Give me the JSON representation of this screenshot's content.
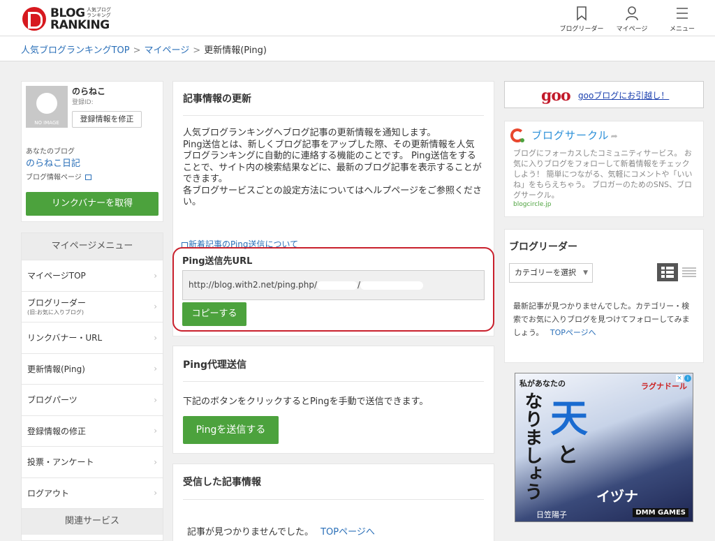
{
  "header": {
    "logo_line1": "BLOG",
    "logo_line2": "RANKING",
    "logo_sub": "人気ブログランキング",
    "nav": [
      {
        "label": "ブログリーダー",
        "icon": "bookmark-icon"
      },
      {
        "label": "マイページ",
        "icon": "user-icon"
      },
      {
        "label": "メニュー",
        "icon": "hamburger-icon"
      }
    ]
  },
  "breadcrumb": {
    "items": [
      "人気ブログランキングTOP",
      "マイページ"
    ],
    "separator": ">",
    "current": "更新情報(Ping)"
  },
  "profile": {
    "noimage_label": "NO IMAGE",
    "name": "のらねこ",
    "id_label": "登録ID:",
    "edit_button": "登録情報を修正",
    "blog_label": "あなたのブログ",
    "blog_name": "のらねこ日記",
    "blog_info": "ブログ情報ページ",
    "link_banner_button": "リンクバナーを取得"
  },
  "menu": {
    "head": "マイページメニュー",
    "items": [
      {
        "label": "マイページTOP",
        "sub": ""
      },
      {
        "label": "ブログリーダー",
        "sub": "(旧:お気に入りブログ)"
      },
      {
        "label": "リンクバナー・URL",
        "sub": ""
      },
      {
        "label": "更新情報(Ping)",
        "sub": ""
      },
      {
        "label": "ブログパーツ",
        "sub": ""
      },
      {
        "label": "登録情報の修正",
        "sub": ""
      },
      {
        "label": "投票・アンケート",
        "sub": ""
      },
      {
        "label": "ログアウト",
        "sub": ""
      }
    ],
    "foot": "関連サービス"
  },
  "update_card": {
    "title": "記事情報の更新",
    "desc1": "人気ブログランキングへブログ記事の更新情報を通知します。",
    "desc2": "Ping送信とは、新しくブログ記事をアップした際、その更新情報を人気ブログランキングに自動的に連絡する機能のことです。 Ping送信をすることで、サイト内の検索結果などに、最新のブログ記事を表示することができます。",
    "desc3": "各ブログサービスごとの設定方法についてはヘルプページをご参照ください。",
    "ping_link": "新着記事のPing送信について",
    "url_title": "Ping送信先URL",
    "url_value": "http://blog.with2.net/ping.php/",
    "url_slash": "/",
    "copy_button": "コピーする"
  },
  "proxy_card": {
    "title": "Ping代理送信",
    "desc": "下記のボタンをクリックするとPingを手動で送信できます。",
    "send_button": "Pingを送信する"
  },
  "received_card": {
    "title": "受信した記事情報",
    "empty": "記事が見つかりませんでした。",
    "top_link": "TOPページへ"
  },
  "goo": {
    "logo": "goo",
    "link": "gooブログにお引越し！"
  },
  "circle": {
    "title": "ブログサークル",
    "desc": "ブログにフォーカスしたコミュニティサービス。 お気に入りブログをフォローして新着情報をチェックしよう！ 簡単につながる、気軽にコメントや「いいね」をもらえちゃう。 ブロガーのためのSNS、ブログサークル。",
    "url": "blogcircle.jp"
  },
  "reader": {
    "title": "ブログリーダー",
    "category_placeholder": "カテゴリーを選択",
    "empty": "最新記事が見つかりませんでした。カテゴリー・検索でお気に入りブログを見つけてフォローしてみましょう。",
    "top_link": "TOPページへ"
  },
  "ad": {
    "line1": "私があなたの",
    "vertical": "なりましょう",
    "ten": "天",
    "to": "と",
    "brand": "ラグナドール",
    "name": "イヅナ",
    "author": "日笠陽子",
    "publisher": "DMM GAMES"
  }
}
